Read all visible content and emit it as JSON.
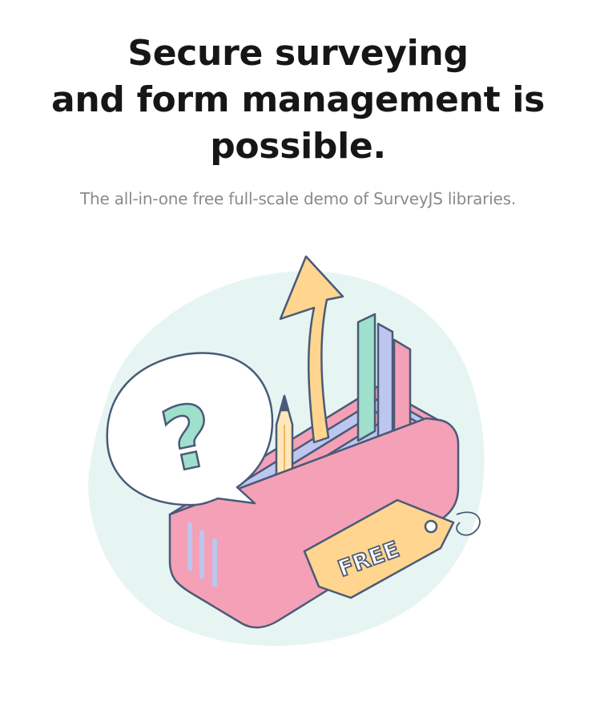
{
  "hero": {
    "title_lines": [
      "Secure surveying",
      "and form management is",
      "possible."
    ],
    "subtitle": "The all-in-one free full-scale demo of SurveyJS libraries."
  },
  "illustration": {
    "question_mark": "?",
    "tag_text": "FREE",
    "icons": [
      "speech-bubble-icon",
      "question-mark-icon",
      "arrow-up-icon",
      "bar-chart-icon",
      "pencil-icon",
      "price-tag-icon"
    ]
  },
  "colors": {
    "title": "#161616",
    "subtitle": "#8a8a8a",
    "outline": "#4a5a78",
    "pink": "#f4a0b6",
    "mint": "#9ee0cc",
    "lavender": "#bcc6ef",
    "yellow": "#ffd58f",
    "blob": "#e6f5f2"
  }
}
